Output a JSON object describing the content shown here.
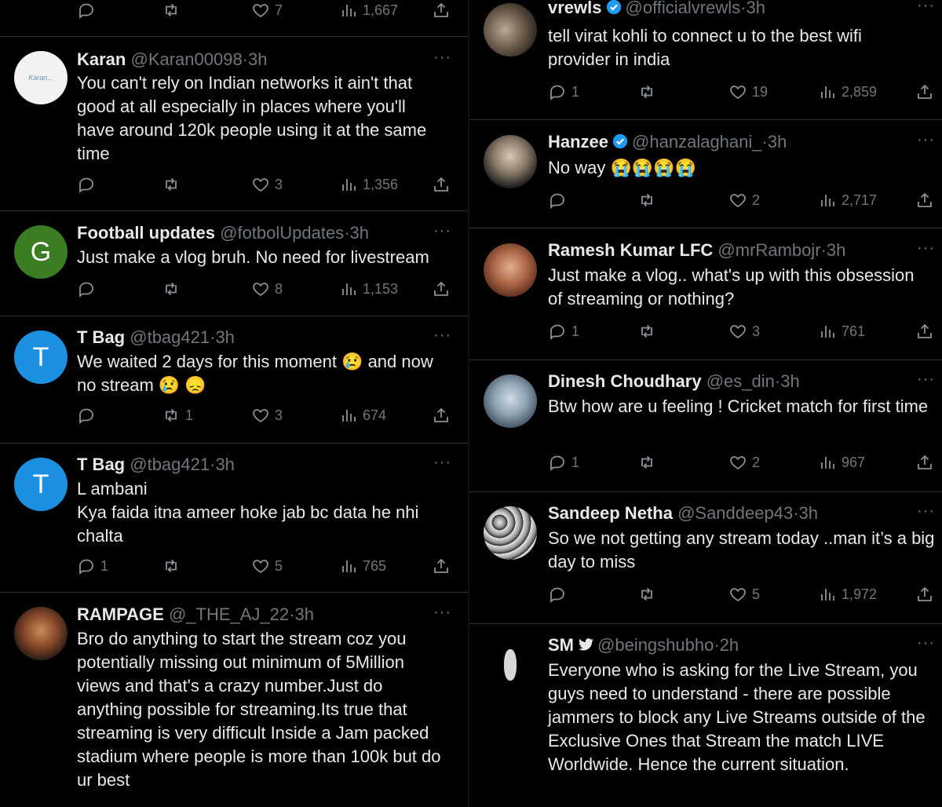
{
  "left": {
    "top_row": {
      "replies": "",
      "retweets": "",
      "likes": "7",
      "views": "1,667"
    },
    "tweets": [
      {
        "name": "Karan",
        "handle": "@Karan00098",
        "time": "3h",
        "avatar_text": "Karan...",
        "text": "You can't rely on Indian networks it ain't that good at all especially in places where you'll have around 120k people using it at the same time",
        "replies": "",
        "retweets": "",
        "likes": "3",
        "views": "1,356"
      },
      {
        "name": "Football updates",
        "handle": "@fotbolUpdates",
        "time": "3h",
        "avatar_letter": "G",
        "text": "Just make a vlog bruh. No need for livestream",
        "replies": "",
        "retweets": "",
        "likes": "8",
        "views": "1,153"
      },
      {
        "name": "T Bag",
        "handle": "@tbag421",
        "time": "3h",
        "avatar_letter": "T",
        "text": "We waited 2 days for this moment 😢 and now no stream 😢 😞",
        "replies": "",
        "retweets": "1",
        "likes": "3",
        "views": "674"
      },
      {
        "name": "T Bag",
        "handle": "@tbag421",
        "time": "3h",
        "avatar_letter": "T",
        "text": "L ambani\nKya faida itna ameer hoke jab bc data he nhi chalta",
        "replies": "1",
        "retweets": "",
        "likes": "5",
        "views": "765"
      },
      {
        "name": "RAMPAGE",
        "handle": "@_THE_AJ_22",
        "time": "3h",
        "text": "Bro do anything to start the stream coz you potentially missing out minimum of 5Million views and that's a crazy number.Just do anything possible for streaming.Its true that streaming is very difficult Inside a Jam packed stadium where people is more than 100k but do ur best"
      }
    ]
  },
  "right": {
    "tweets": [
      {
        "name": "vrewls",
        "handle": "@officialvrewls",
        "time": "3h",
        "text": "tell virat kohli to connect u to the best wifi provider in india",
        "replies": "1",
        "retweets": "",
        "likes": "19",
        "views": "2,859"
      },
      {
        "name": "Hanzee",
        "handle": "@hanzalaghani_",
        "time": "3h",
        "text": "No way 😭😭😭😭",
        "replies": "",
        "retweets": "",
        "likes": "2",
        "views": "2,717"
      },
      {
        "name": "Ramesh Kumar LFC",
        "handle": "@mrRambojr",
        "time": "3h",
        "text": "Just make a vlog.. what's up with this obsession of streaming or nothing?",
        "replies": "1",
        "retweets": "",
        "likes": "3",
        "views": "761"
      },
      {
        "name": "Dinesh Choudhary",
        "handle": "@es_din",
        "time": "3h",
        "text": "Btw how are u feeling ! Cricket match for first time",
        "replies": "1",
        "retweets": "",
        "likes": "2",
        "views": "967"
      },
      {
        "name": "Sandeep Netha",
        "handle": "@Sanddeep43",
        "time": "3h",
        "text": "So we not getting any stream today ..man it’s a big day to miss",
        "replies": "",
        "retweets": "",
        "likes": "5",
        "views": "1,972"
      },
      {
        "name": "SM",
        "handle": "@beingshubho",
        "time": "2h",
        "text": "Everyone who is asking for the Live Stream, you guys need to understand - there are possible jammers to block any Live Streams outside of the Exclusive Ones that Stream the match LIVE Worldwide. Hence the current situation."
      }
    ]
  },
  "common": {
    "dot": "·",
    "more": "···"
  },
  "colors": {
    "verified": "#1d9bf0",
    "football_avatar": "#3a7d23",
    "tbag_avatar": "#1d8fe1"
  }
}
